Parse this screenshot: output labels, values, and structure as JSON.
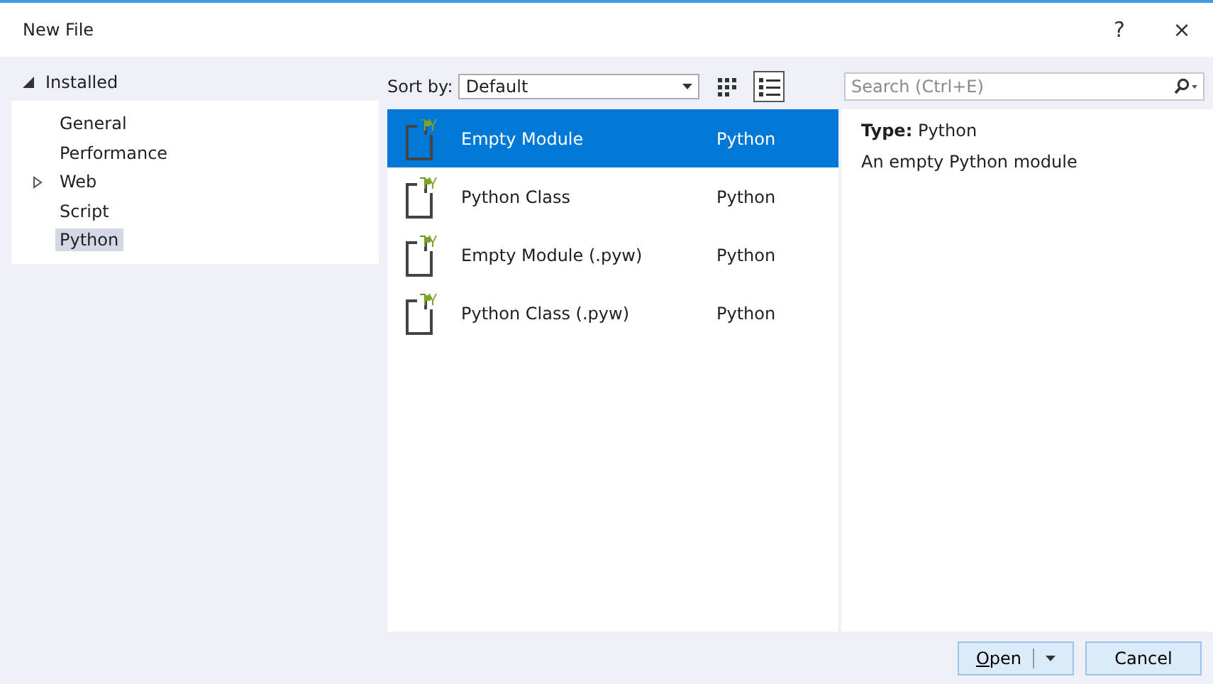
{
  "window": {
    "title": "New File",
    "help": "?",
    "close": "×"
  },
  "tree": {
    "label": "Installed",
    "expanded": true,
    "children": [
      {
        "label": "General",
        "selected": false
      },
      {
        "label": "Performance",
        "selected": false
      },
      {
        "label": "Web",
        "selected": false,
        "expanded": false
      },
      {
        "label": "Script",
        "selected": false
      },
      {
        "label": "Python",
        "selected": true
      }
    ]
  },
  "toolbar": {
    "sort_label": "Sort by:",
    "sort_value": "Default",
    "views": [
      {
        "kind": "grid",
        "selected": false
      },
      {
        "kind": "list",
        "selected": true
      }
    ]
  },
  "search": {
    "placeholder": "Search (Ctrl+E)"
  },
  "templates": [
    {
      "name": "Empty Module",
      "language": "Python",
      "selected": true
    },
    {
      "name": "Python Class",
      "language": "Python",
      "selected": false
    },
    {
      "name": "Empty Module (.pyw)",
      "language": "Python",
      "selected": false
    },
    {
      "name": "Python Class (.pyw)",
      "language": "Python",
      "selected": false
    }
  ],
  "details": {
    "type_label": "Type:",
    "type_value": "Python",
    "description": "An empty Python module"
  },
  "buttons": [
    {
      "label": "Open",
      "kind": "split"
    },
    {
      "label": "Cancel",
      "kind": "plain"
    }
  ]
}
